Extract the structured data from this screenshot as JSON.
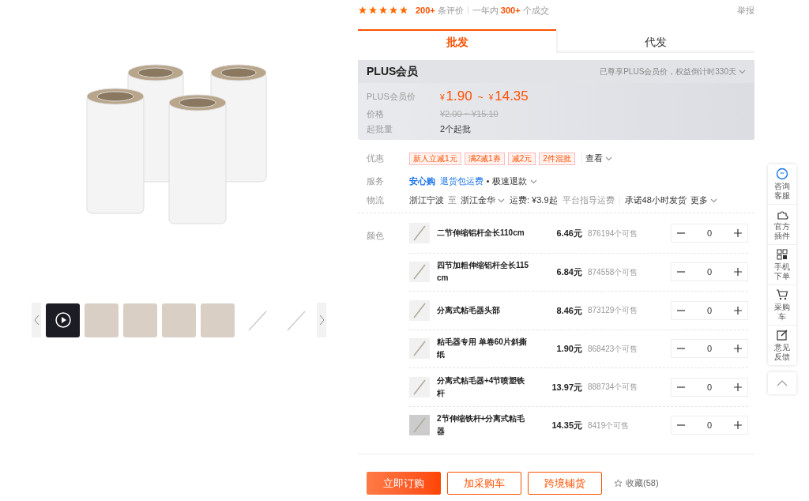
{
  "rating": {
    "stars": 5,
    "review_count": "200+",
    "review_label": "条评价",
    "year_label": "一年内",
    "deal_count": "300+",
    "deal_label": "个成交",
    "report": "举报"
  },
  "gallery": {
    "thumbnails": [
      {
        "kind": "video",
        "selected": false
      },
      {
        "kind": "photo",
        "selected": false
      },
      {
        "kind": "photo",
        "selected": false
      },
      {
        "kind": "photo",
        "selected": false
      },
      {
        "kind": "photo",
        "selected": false
      },
      {
        "kind": "white",
        "selected": false
      },
      {
        "kind": "white",
        "selected": false
      }
    ]
  },
  "tabs": [
    {
      "label": "批发",
      "selected": true
    },
    {
      "label": "代发",
      "selected": false
    }
  ],
  "plus": {
    "title": "PLUS会员",
    "note": "已尊享PLUS会员价，权益倒计时330天",
    "price_label": "PLUS会员价",
    "currency_low": "¥",
    "price_low": "1.90",
    "range_sep": "~",
    "currency_high": "¥",
    "price_high": "14.35",
    "original_label": "价格",
    "original_price": "¥2.00 ~ ¥15.10",
    "min_label": "起批量",
    "min_value": "2个起批"
  },
  "promotions": {
    "label": "优惠",
    "tags": [
      "新人立减1元",
      "满2减1券",
      "减2元",
      "2件混批"
    ],
    "view": "查看"
  },
  "service": {
    "label": "服务",
    "brand": "安心购",
    "items": [
      "退货包运费",
      "极速退款"
    ]
  },
  "logistics": {
    "label": "物流",
    "from": "浙江宁波",
    "to_word": "至",
    "to": "浙江金华",
    "fee": "运费: ¥3.9起",
    "guide": "平台指导运费",
    "promise": "承诺48小时发货",
    "more": "更多"
  },
  "variants": {
    "label": "颜色",
    "items": [
      {
        "name": "二节伸缩铝杆全长110cm",
        "price": "6.46元",
        "stock": "876194个可售",
        "quantity": "0"
      },
      {
        "name": "四节加粗伸缩铝杆全长115cm",
        "price": "6.84元",
        "stock": "874558个可售",
        "quantity": "0"
      },
      {
        "name": "分离式粘毛器头部",
        "price": "8.46元",
        "stock": "873129个可售",
        "quantity": "0"
      },
      {
        "name": "粘毛器专用 单卷60片斜撕纸",
        "price": "1.90元",
        "stock": "868423个可售",
        "quantity": "0"
      },
      {
        "name": "分离式粘毛器+4节喷塑铁杆",
        "price": "13.97元",
        "stock": "888734个可售",
        "quantity": "0"
      },
      {
        "name": "2节伸缩铁杆+分离式粘毛器",
        "price": "14.35元",
        "stock": "8419个可售",
        "quantity": "0"
      }
    ]
  },
  "actions": {
    "buttons": [
      {
        "label": "立即订购",
        "kind": "primary"
      },
      {
        "label": "加采购车",
        "kind": "outline"
      },
      {
        "label": "跨境铺货",
        "kind": "outline"
      }
    ],
    "favorite": "收藏(58)"
  },
  "sidebar": {
    "items": [
      {
        "label": "咨询客服",
        "kind": "chat"
      },
      {
        "label": "官方插件",
        "kind": "puzzle"
      },
      {
        "label": "手机下单",
        "kind": "qr"
      },
      {
        "label": "采购车",
        "kind": "cart"
      },
      {
        "label": "意见反馈",
        "kind": "edit"
      }
    ]
  }
}
